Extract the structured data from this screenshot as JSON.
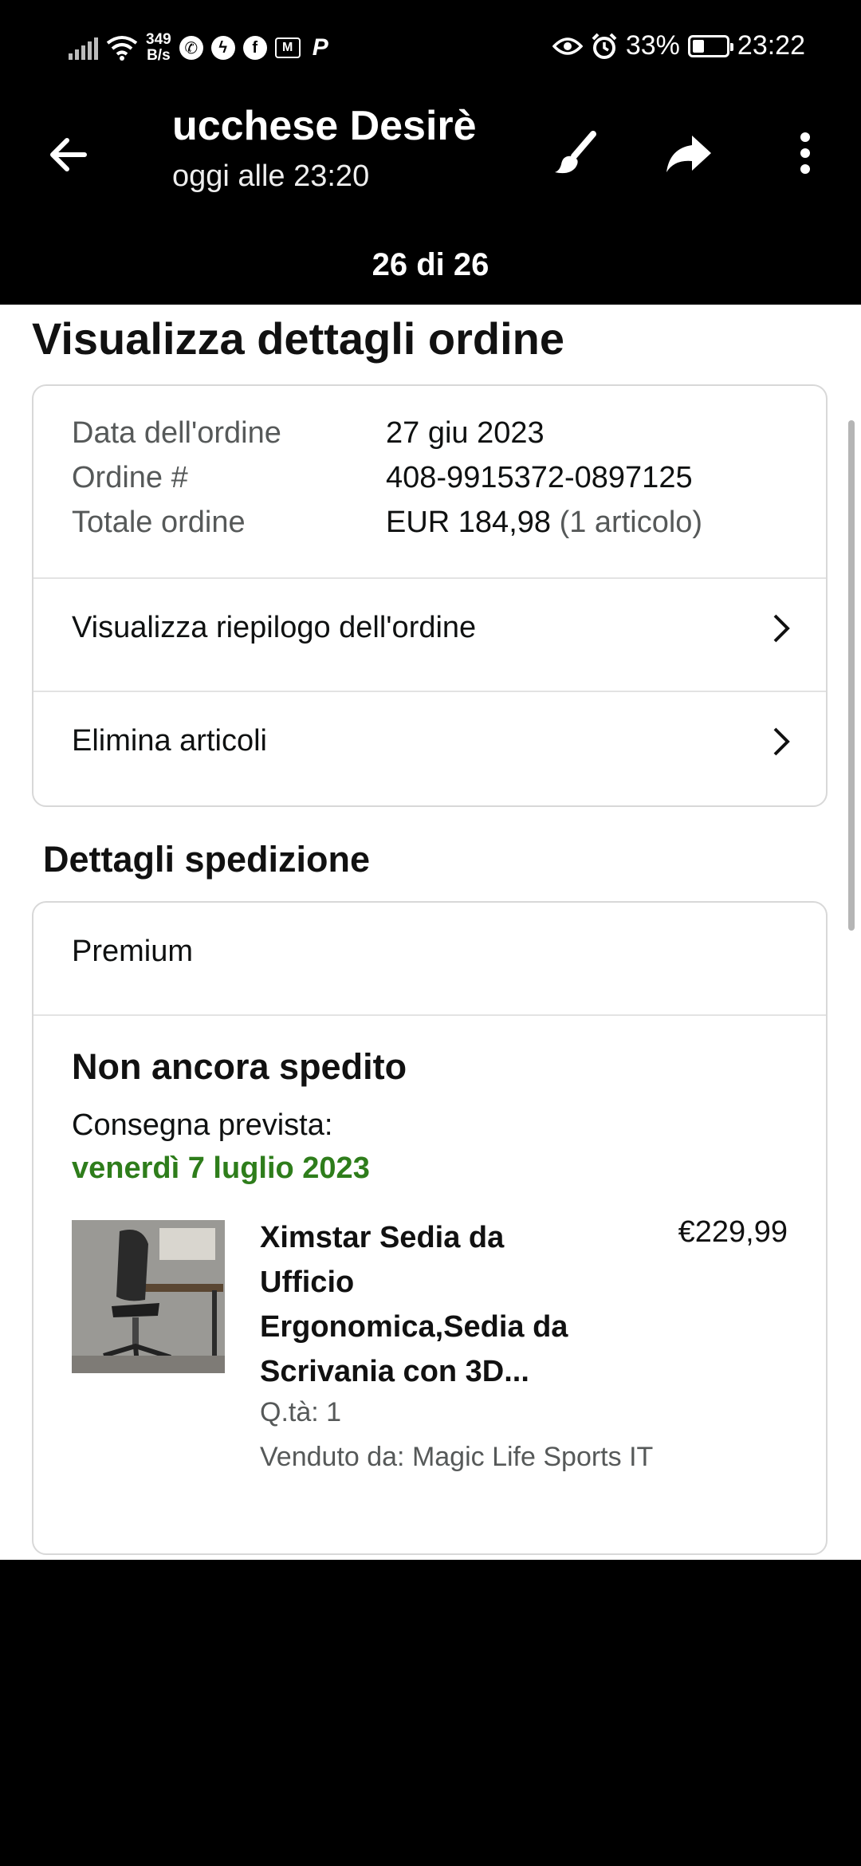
{
  "status_bar": {
    "net_speed_value": "349",
    "net_speed_unit": "B/s",
    "battery_percent": "33%",
    "time": "23:22"
  },
  "viewer": {
    "sender": "ucchese   Desirè",
    "timestamp": "oggi alle 23:20",
    "counter": "26 di 26"
  },
  "page": {
    "title": "Visualizza dettagli ordine",
    "order": {
      "date_label": "Data dell'ordine",
      "date_value": "27 giu 2023",
      "number_label": "Ordine #",
      "number_value": "408-9915372-0897125",
      "total_label": "Totale ordine",
      "total_value": "EUR 184,98",
      "total_items": "(1 articolo)"
    },
    "links": {
      "summary": "Visualizza riepilogo dell'ordine",
      "delete": "Elimina articoli"
    },
    "shipping_heading": "Dettagli spedizione",
    "shipping": {
      "method": "Premium",
      "status": "Non ancora spedito",
      "eta_label": "Consegna prevista:",
      "eta_date": "venerdì 7 luglio 2023",
      "accent_color": "#2e7d1b"
    },
    "item": {
      "title_line1": "Ximstar Sedia da",
      "title_line2": "Ufficio",
      "title_line3": "Ergonomica,Sedia da",
      "title_line4": "Scrivania con 3D...",
      "price": "€229,99",
      "qty": "Q.tà: 1",
      "seller": "Venduto da: Magic Life Sports IT"
    }
  }
}
